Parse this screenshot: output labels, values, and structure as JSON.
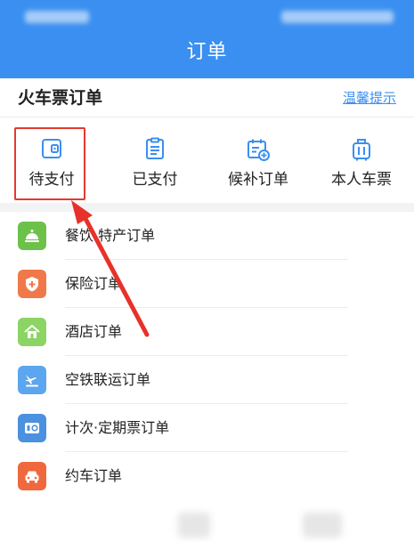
{
  "header": {
    "title": "订单"
  },
  "train": {
    "title": "火车票订单",
    "tip_link": "温馨提示",
    "tabs": [
      {
        "label": "待支付",
        "icon": "wallet-icon"
      },
      {
        "label": "已支付",
        "icon": "receipt-icon"
      },
      {
        "label": "候补订单",
        "icon": "calendar-add-icon"
      },
      {
        "label": "本人车票",
        "icon": "luggage-icon"
      }
    ]
  },
  "orders": [
    {
      "label": "餐饮·特产订单",
      "icon": "bell-cloche-icon",
      "color": "#6cc14a"
    },
    {
      "label": "保险订单",
      "icon": "shield-plus-icon",
      "color": "#f0794a"
    },
    {
      "label": "酒店订单",
      "icon": "house-icon",
      "color": "#8cd464"
    },
    {
      "label": "空铁联运订单",
      "icon": "plane-train-icon",
      "color": "#5ba6ee"
    },
    {
      "label": "计次·定期票订单",
      "icon": "ticket-icon",
      "color": "#4c90e0"
    },
    {
      "label": "约车订单",
      "icon": "car-icon",
      "color": "#f0683e"
    }
  ],
  "colors": {
    "accent": "#3a8ff0",
    "highlight": "#e33a2f"
  }
}
